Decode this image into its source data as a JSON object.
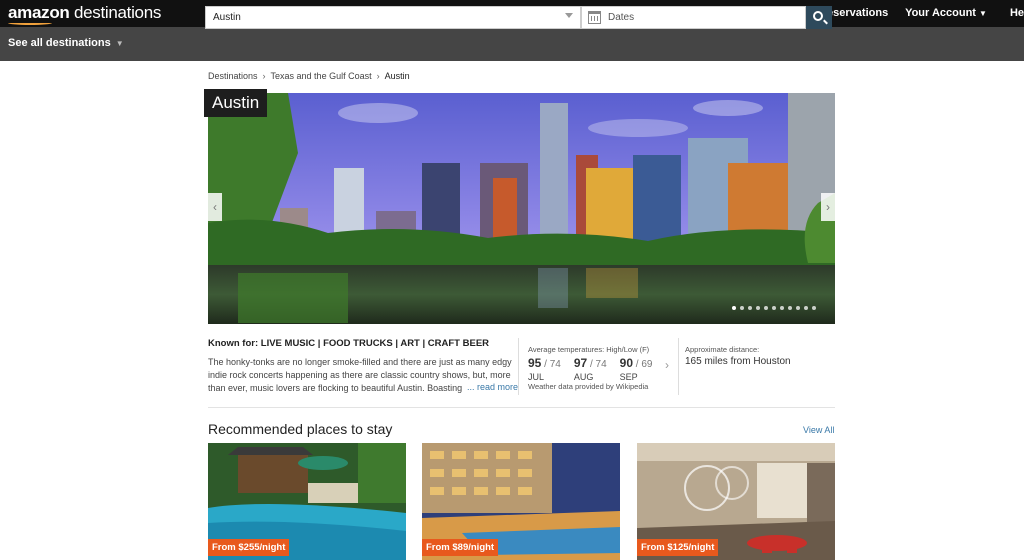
{
  "header": {
    "logo_brand": "amazon",
    "logo_sub": "destinations",
    "nav": [
      "Your Reservations",
      "Your Account",
      "He"
    ]
  },
  "search": {
    "see_all": "See all destinations",
    "destination_value": "Austin",
    "dates_placeholder": "Dates"
  },
  "breadcrumb": [
    "Destinations",
    "Texas and the Gulf Coast",
    "Austin"
  ],
  "hero": {
    "city": "Austin",
    "slide_count": 11,
    "active_slide": 1
  },
  "info": {
    "known_for_label": "Known for:",
    "known_for": "LIVE MUSIC | FOOD TRUCKS | ART | CRAFT BEER",
    "description": "The honky-tonks are no longer smoke-filled and there are just as many edgy indie rock concerts happening as there are classic country shows, but, more than ever, music lovers are flocking to beautiful Austin. Boasting",
    "read_more": "... read more",
    "temps_header": "Average temperatures: High/Low (F)",
    "temps": [
      {
        "high": "95",
        "low": "74",
        "month": "JUL"
      },
      {
        "high": "97",
        "low": "74",
        "month": "AUG"
      },
      {
        "high": "90",
        "low": "69",
        "month": "SEP"
      }
    ],
    "weather_source": "Weather data provided by Wikipedia",
    "distance_header": "Approximate distance:",
    "distance": "165 miles from Houston"
  },
  "recommended": {
    "title": "Recommended places to stay",
    "view_all": "View All",
    "cards": [
      {
        "price": "From $255/night"
      },
      {
        "price": "From $89/night"
      },
      {
        "price": "From $125/night"
      }
    ]
  },
  "colors": {
    "topbar": "#111111",
    "searchbar": "#454545",
    "search_button": "#2e4a5c",
    "price_badge": "#e8591d",
    "link": "#3a79a8"
  }
}
